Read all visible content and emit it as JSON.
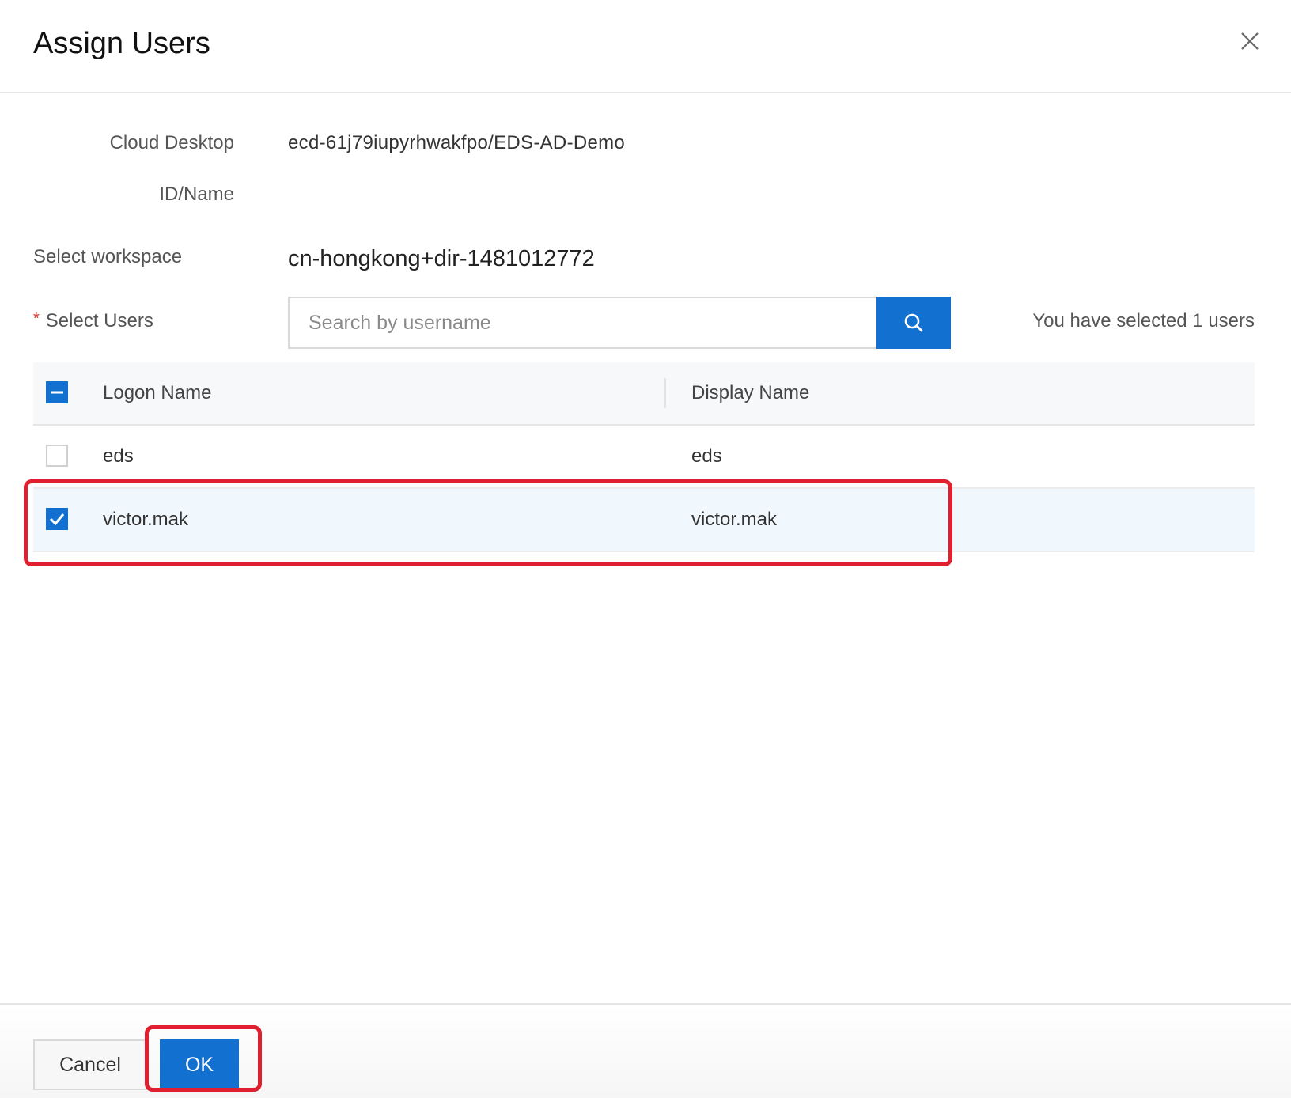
{
  "dialog": {
    "title": "Assign Users",
    "close_icon": "close-icon"
  },
  "form": {
    "cloud_desktop_label_line1": "Cloud Desktop",
    "cloud_desktop_label_line2": "ID/Name",
    "cloud_desktop_value": "ecd-61j79iupyrhwakfpo/EDS-AD-Demo",
    "workspace_label": "Select workspace",
    "workspace_value": "cn-hongkong+dir-1481012772",
    "users_label": "Select Users",
    "required_marker": "*",
    "search": {
      "placeholder": "Search by username",
      "value": "",
      "button_icon": "search-icon"
    },
    "selected_count_text": "You have selected 1 users"
  },
  "table": {
    "headers": {
      "logon_name": "Logon Name",
      "display_name": "Display Name"
    },
    "select_all_state": "indeterminate",
    "rows": [
      {
        "logon_name": "eds",
        "display_name": "eds",
        "checked": false
      },
      {
        "logon_name": "victor.mak",
        "display_name": "victor.mak",
        "checked": true
      }
    ]
  },
  "footer": {
    "cancel_label": "Cancel",
    "ok_label": "OK"
  },
  "colors": {
    "primary": "#1270d1",
    "highlight": "#e0202f",
    "selected_row": "#f0f7fd"
  }
}
